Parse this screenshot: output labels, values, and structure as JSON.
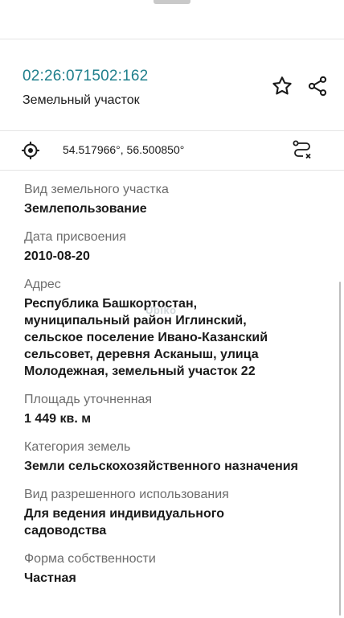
{
  "header": {
    "cadastral_number": "02:26:071502:162",
    "object_type": "Земельный участок"
  },
  "location": {
    "coordinates": "54.517966°, 56.500850°"
  },
  "watermark": "Ubiko",
  "fields": [
    {
      "label": "Вид земельного участка",
      "value": "Землепользование"
    },
    {
      "label": "Дата присвоения",
      "value": "2010-08-20"
    },
    {
      "label": "Адрес",
      "value": "Республика Башкортостан,\nмуниципальный район Иглинский,\nсельское поселение Ивано-Казанский\nсельсовет, деревня Асканыш, улица\nМолодежная, земельный участок 22"
    },
    {
      "label": "Площадь уточненная",
      "value": "1 449 кв. м"
    },
    {
      "label": "Категория земель",
      "value": "Земли сельскохозяйственного назначения"
    },
    {
      "label": "Вид разрешенного использования",
      "value": "Для ведения индивидуального\nсадоводства"
    },
    {
      "label": "Форма собственности",
      "value": "Частная"
    }
  ],
  "icons": {
    "favorite": "star-icon",
    "share": "share-icon",
    "locate": "crosshair-icon",
    "route": "route-icon"
  }
}
